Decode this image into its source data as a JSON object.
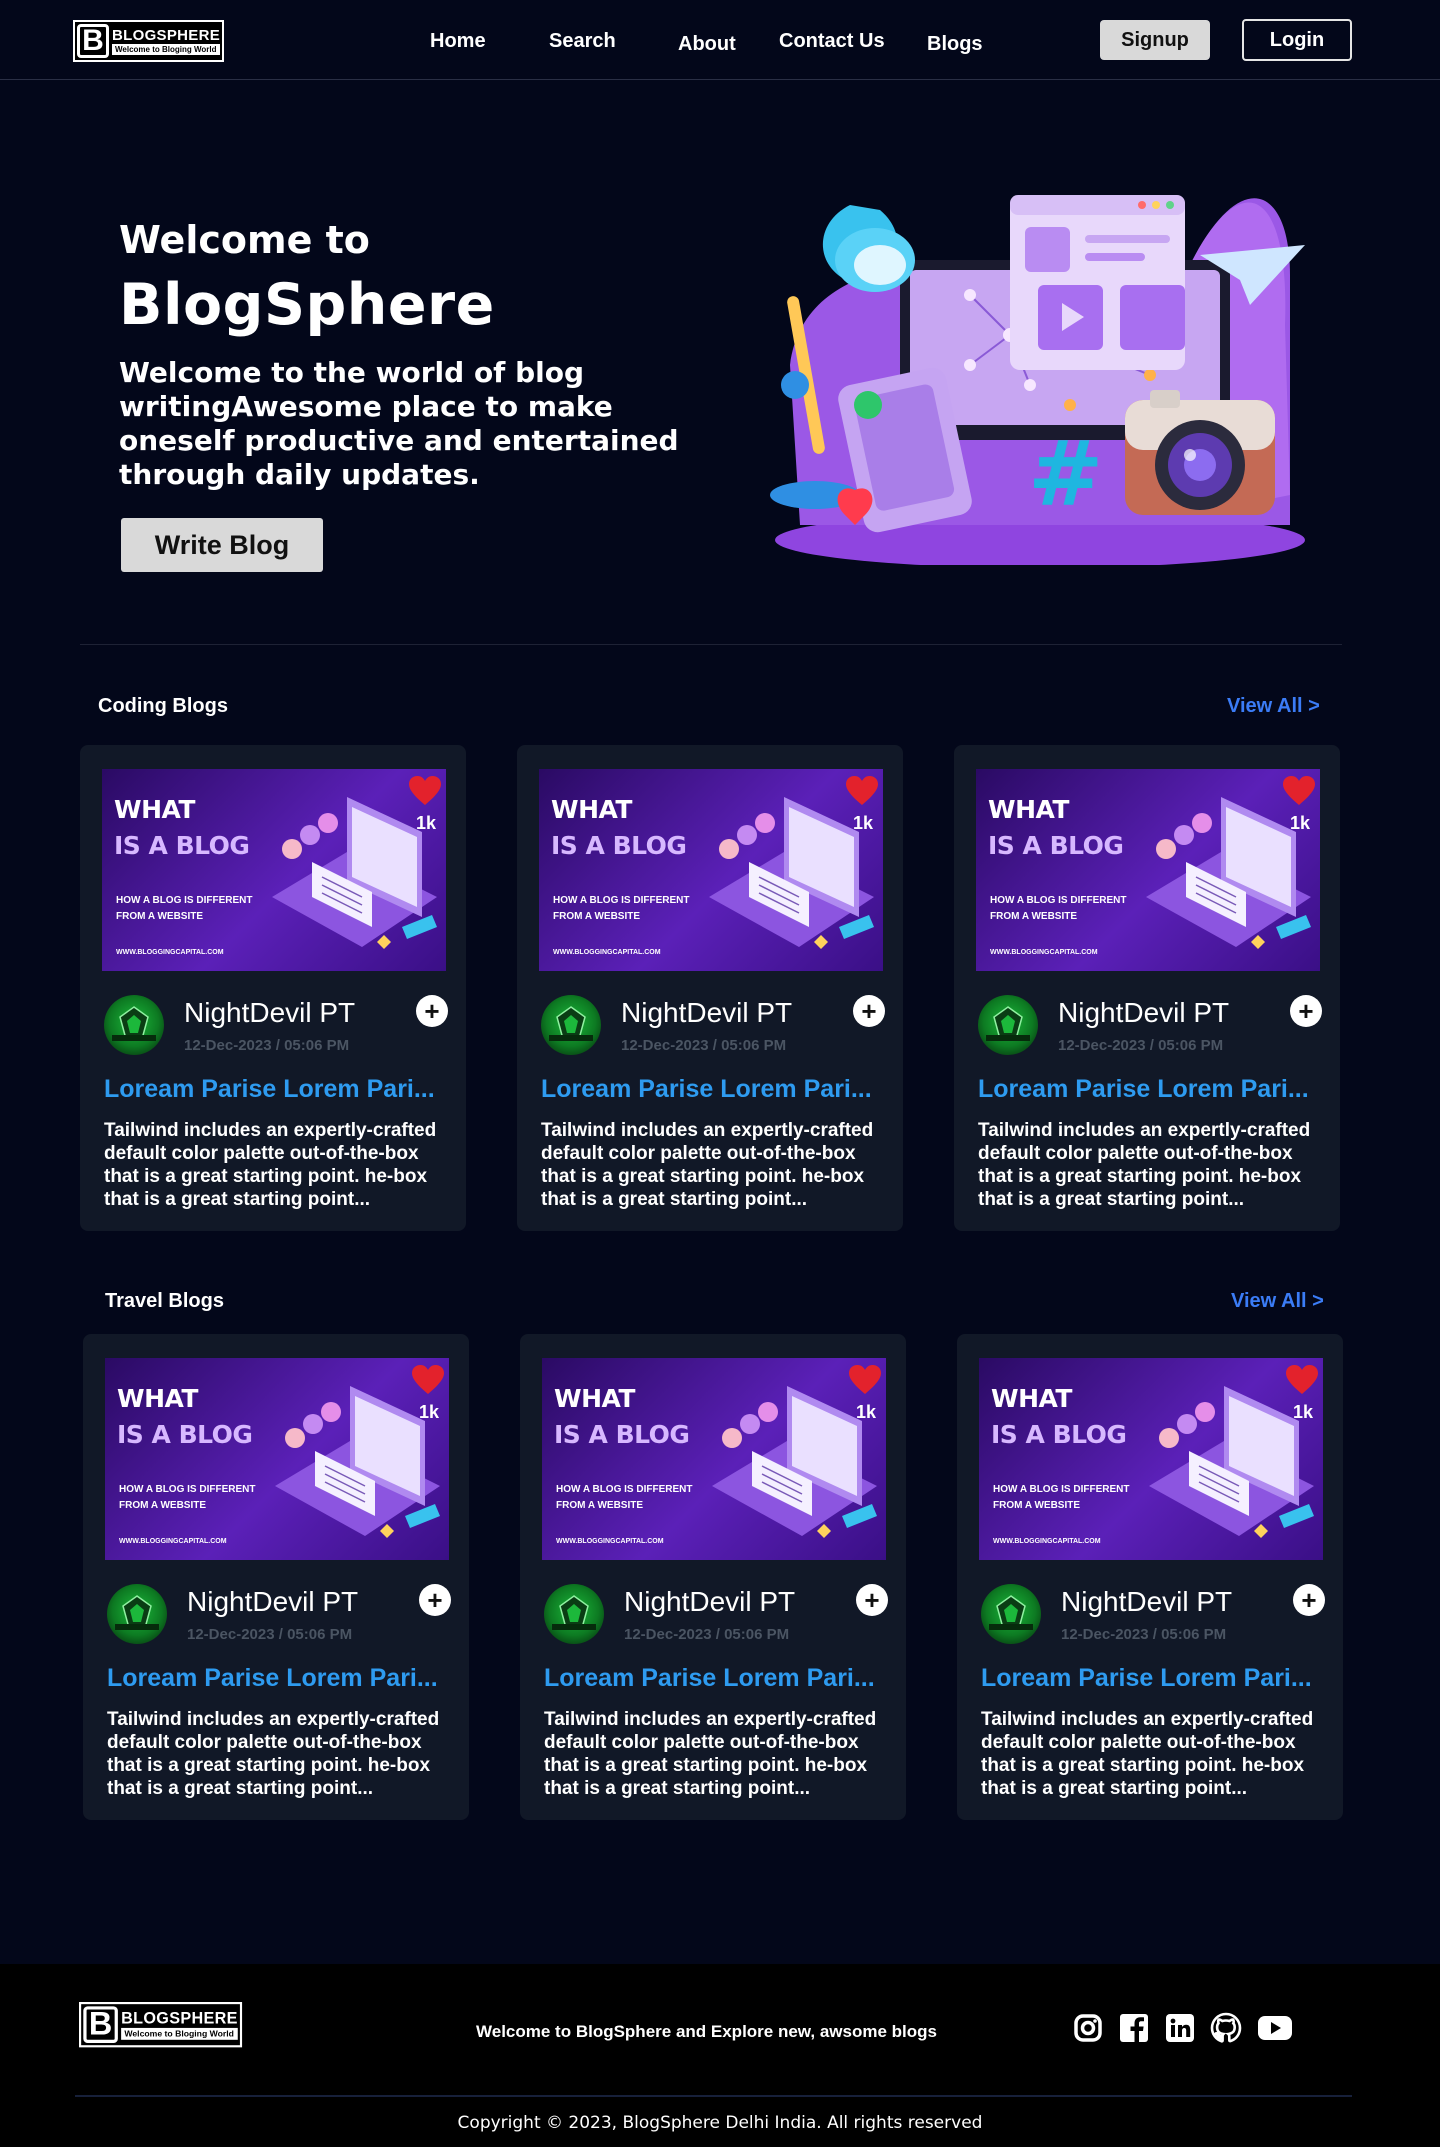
{
  "nav": {
    "logo": {
      "brand": "BLOGSPHERE",
      "tagline": "Welcome to Bloging World"
    },
    "links": [
      "Home",
      "Search",
      "About",
      "Contact Us",
      "Blogs"
    ],
    "signup_label": "Signup",
    "login_label": "Login"
  },
  "hero": {
    "welcome": "Welcome to",
    "title": "BlogSphere",
    "description": "Welcome to the world of blog writingAwesome place to make oneself productive and entertained through daily updates.",
    "button_label": "Write Blog"
  },
  "sections": [
    {
      "title": "Coding Blogs",
      "view_all": "View All >",
      "cards": [
        {
          "thumb": {
            "line1": "WHAT",
            "line2": "IS A BLOG",
            "subtitle": "HOW A BLOG IS DIFFERENT FROM A WEBSITE",
            "site": "WWW.BLOGGINGCAPITAL.COM"
          },
          "likes": "1k",
          "author": "NightDevil PT",
          "date": "12-Dec-2023 / 05:06 PM",
          "title": "Loream Parise Lorem Pari...",
          "description": "Tailwind includes an expertly-crafted default color palette out-of-the-box that is a great starting point. he-box that is a great starting point..."
        },
        {
          "thumb": {
            "line1": "WHAT",
            "line2": "IS A BLOG",
            "subtitle": "HOW A BLOG IS DIFFERENT FROM A WEBSITE",
            "site": "WWW.BLOGGINGCAPITAL.COM"
          },
          "likes": "1k",
          "author": "NightDevil PT",
          "date": "12-Dec-2023 / 05:06 PM",
          "title": "Loream Parise Lorem Pari...",
          "description": "Tailwind includes an expertly-crafted default color palette out-of-the-box that is a great starting point. he-box that is a great starting point..."
        },
        {
          "thumb": {
            "line1": "WHAT",
            "line2": "IS A BLOG",
            "subtitle": "HOW A BLOG IS DIFFERENT FROM A WEBSITE",
            "site": "WWW.BLOGGINGCAPITAL.COM"
          },
          "likes": "1k",
          "author": "NightDevil PT",
          "date": "12-Dec-2023 / 05:06 PM",
          "title": "Loream Parise Lorem Pari...",
          "description": "Tailwind includes an expertly-crafted default color palette out-of-the-box that is a great starting point. he-box that is a great starting point..."
        }
      ]
    },
    {
      "title": "Travel Blogs",
      "view_all": "View All >",
      "cards": [
        {
          "thumb": {
            "line1": "WHAT",
            "line2": "IS A BLOG",
            "subtitle": "HOW A BLOG IS DIFFERENT FROM A WEBSITE",
            "site": "WWW.BLOGGINGCAPITAL.COM"
          },
          "likes": "1k",
          "author": "NightDevil PT",
          "date": "12-Dec-2023 / 05:06 PM",
          "title": "Loream Parise Lorem Pari...",
          "description": "Tailwind includes an expertly-crafted default color palette out-of-the-box that is a great starting point. he-box that is a great starting point..."
        },
        {
          "thumb": {
            "line1": "WHAT",
            "line2": "IS A BLOG",
            "subtitle": "HOW A BLOG IS DIFFERENT FROM A WEBSITE",
            "site": "WWW.BLOGGINGCAPITAL.COM"
          },
          "likes": "1k",
          "author": "NightDevil PT",
          "date": "12-Dec-2023 / 05:06 PM",
          "title": "Loream Parise Lorem Pari...",
          "description": "Tailwind includes an expertly-crafted default color palette out-of-the-box that is a great starting point. he-box that is a great starting point..."
        },
        {
          "thumb": {
            "line1": "WHAT",
            "line2": "IS A BLOG",
            "subtitle": "HOW A BLOG IS DIFFERENT FROM A WEBSITE",
            "site": "WWW.BLOGGINGCAPITAL.COM"
          },
          "likes": "1k",
          "author": "NightDevil PT",
          "date": "12-Dec-2023 / 05:06 PM",
          "title": "Loream Parise Lorem Pari...",
          "description": "Tailwind includes an expertly-crafted default color palette out-of-the-box that is a great starting point. he-box that is a great starting point..."
        }
      ]
    }
  ],
  "footer": {
    "logo": {
      "brand": "BLOGSPHERE",
      "tagline": "Welcome to Bloging World"
    },
    "text": "Welcome to BlogSphere and Explore new, awsome blogs",
    "socials": [
      "instagram-icon",
      "facebook-icon",
      "linkedin-icon",
      "github-icon",
      "youtube-icon"
    ],
    "copyright": "Copyright © 2023, BlogSphere Delhi India. All rights reserved"
  },
  "colors": {
    "background": "#03071a",
    "card": "#111827",
    "accent_blue": "#3b7cf6",
    "title_blue": "#2e9bf0",
    "button_gray": "#d9d9d9"
  }
}
